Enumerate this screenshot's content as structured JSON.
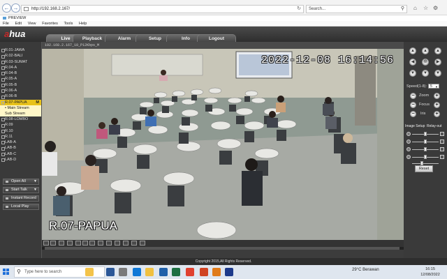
{
  "browser": {
    "url": "http://192.168.2.167/",
    "search_placeholder": "Search...",
    "tab_title": "PREVIEW",
    "menu": [
      "File",
      "Edit",
      "View",
      "Favorites",
      "Tools",
      "Help"
    ]
  },
  "app": {
    "logo_a": "a",
    "logo_rest": "hua",
    "tabs": [
      "Live",
      "Playback",
      "Alarm",
      "Setup",
      "Info",
      "Logout"
    ],
    "active_tab": "Live",
    "footer": "Copyright 2015,All Rights Reserved."
  },
  "channels": [
    "R.01-JAWA",
    "R.02-BALI",
    "R.03-SUMAT",
    "R.04-A",
    "R.04-B",
    "R.05-A",
    "R.05-B",
    "R.06-A",
    "R.06-B"
  ],
  "selected_channel": {
    "label": "R.07-PAPUA",
    "badge": "M"
  },
  "streams": [
    "Main Stream",
    "Sub Stream"
  ],
  "channels_after": [
    "R.08-LOMBO",
    "R.09",
    "R.10",
    "R.11",
    "LAB-A",
    "LAB-B",
    "LAB-C",
    "LAB-D"
  ],
  "left_buttons": {
    "open_all": "Open All",
    "start_talk": "Start Talk",
    "instant_record": "Instant Record",
    "local_play": "Local Play"
  },
  "video": {
    "header": "192.168.2.167_10_P12Kbps_M",
    "osd_time": "2022-12-08 16:14:56",
    "osd_name": "R.07-PAPUA"
  },
  "ptz": {
    "speed_label": "Speed(1-8):",
    "speed_value": "5",
    "zoom_label": "Zoom",
    "focus_label": "Focus",
    "iris_label": "Iris",
    "image_setup_tab": "Image Setup",
    "rotate_tab": "Relay-out",
    "reset_label": "Reset",
    "sliders": [
      0.5,
      0.5,
      0.5,
      0.5,
      0.35
    ]
  },
  "taskbar": {
    "search_placeholder": "Type here to search",
    "weather": "29°C  Berawan",
    "time": "16:15",
    "date": "12/08/2022"
  }
}
